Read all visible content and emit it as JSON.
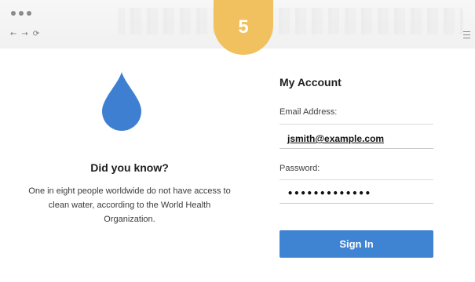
{
  "step_badge": "5",
  "colors": {
    "accent": "#3f83d3",
    "drop": "#3f7fd2",
    "badge": "#f1c05f"
  },
  "chrome": {
    "window_controls": [
      "dot",
      "dot",
      "dot"
    ],
    "nav_icons": [
      "back-arrow-icon",
      "forward-arrow-icon",
      "refresh-icon"
    ],
    "menu_icon": "hamburger-menu-icon"
  },
  "info": {
    "title": "Did you know?",
    "body": "One in eight people worldwide do not have access to clean water, according to the World Health Organization."
  },
  "account": {
    "title": "My Account",
    "email_label": "Email Address:",
    "email_value": "jsmith@example.com",
    "password_label": "Password:",
    "password_value": "•••••••••••••",
    "sign_in_label": "Sign In"
  }
}
